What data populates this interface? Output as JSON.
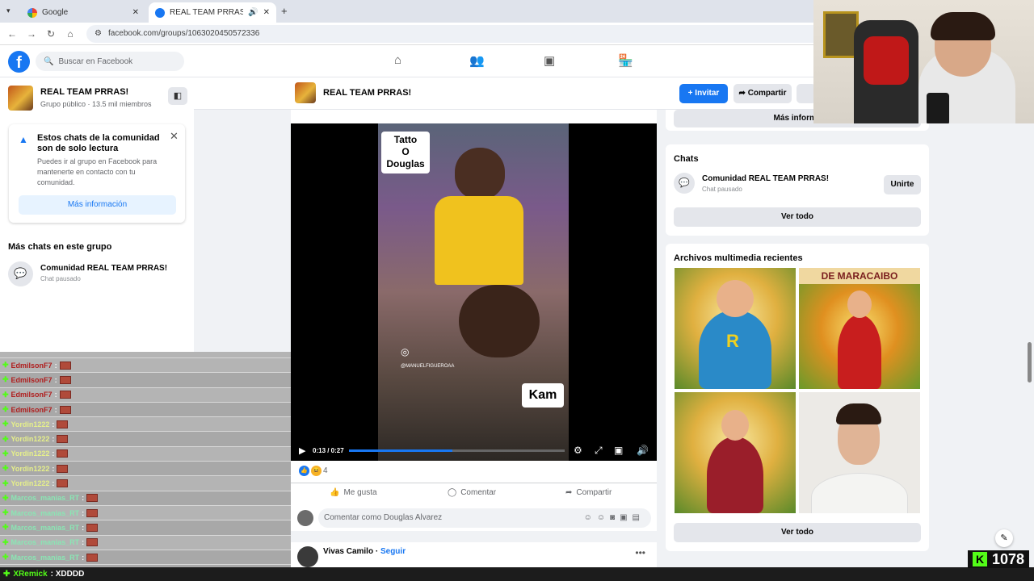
{
  "browser": {
    "tabs": [
      {
        "title": "Google",
        "active": false
      },
      {
        "title": "REAL TEAM PRRAS! | Faceb",
        "active": true
      }
    ],
    "url": "facebook.com/groups/1063020450572336"
  },
  "facebook": {
    "search_placeholder": "Buscar en Facebook",
    "group": {
      "name": "REAL TEAM PRRAS!",
      "meta": "Grupo público · 13.5 mil miembros"
    },
    "notice": {
      "title": "Estos chats de la comunidad son de solo lectura",
      "body": "Puedes ir al grupo en Facebook para mantenerte en contacto con tu comunidad.",
      "button": "Más información"
    },
    "more_chats_title": "Más chats en este grupo",
    "left_chat": {
      "name": "Comunidad REAL TEAM PRRAS!",
      "status": "Chat pausado"
    },
    "groupbar": {
      "title": "REAL TEAM PRRAS!",
      "invite": "Invitar",
      "share": "Compartir"
    }
  },
  "post": {
    "video_labels": {
      "top": [
        "Tatto",
        "O",
        "Douglas"
      ],
      "bottom": "Kam",
      "watermark": "@MANUELFIGUEROAA"
    },
    "video_time": "0:13 / 0:27",
    "video_progress": 0.48,
    "reaction_count": "4",
    "actions": {
      "like": "Me gusta",
      "comment": "Comentar",
      "share": "Compartir"
    },
    "comment_placeholder": "Comentar como Douglas Alvarez"
  },
  "post2": {
    "author": "Vivas Camilo",
    "separator": " · ",
    "follow": "Seguir"
  },
  "right": {
    "more_info_btn": "Más informa",
    "chats_title": "Chats",
    "chat": {
      "name": "Comunidad REAL TEAM PRRAS!",
      "status": "Chat pausado",
      "join": "Unirte"
    },
    "see_all": "Ver todo",
    "media_title": "Archivos multimedia recientes",
    "media_banner": "DE MARACAIBO",
    "media_letter": "R"
  },
  "stream_chat": {
    "rows": [
      {
        "user": "EdmilsonF7",
        "sep": " :",
        "color": "#b01e1e"
      },
      {
        "user": "EdmilsonF7",
        "sep": " :",
        "color": "#b01e1e"
      },
      {
        "user": "EdmilsonF7",
        "sep": " :",
        "color": "#b01e1e"
      },
      {
        "user": "EdmilsonF7",
        "sep": " :",
        "color": "#b01e1e"
      },
      {
        "user": "Yordin1222",
        "sep": " :",
        "color": "#e6f08a"
      },
      {
        "user": "Yordin1222",
        "sep": " :",
        "color": "#e6f08a"
      },
      {
        "user": "Yordin1222",
        "sep": " :",
        "color": "#e6f08a"
      },
      {
        "user": "Yordin1222",
        "sep": " :",
        "color": "#e6f08a"
      },
      {
        "user": "Yordin1222",
        "sep": " :",
        "color": "#e6f08a"
      },
      {
        "user": "Marcos_manias_RT",
        "sep": " :",
        "color": "#8ae6b4"
      },
      {
        "user": "Marcos_manias_RT",
        "sep": " :",
        "color": "#8ae6b4"
      },
      {
        "user": "Marcos_manias_RT",
        "sep": " :",
        "color": "#8ae6b4"
      },
      {
        "user": "Marcos_manias_RT",
        "sep": " :",
        "color": "#8ae6b4"
      },
      {
        "user": "Marcos_manias_RT",
        "sep": " :",
        "color": "#8ae6b4"
      }
    ],
    "last_line": {
      "user": "XRemick",
      "message": ": XDDDD"
    }
  },
  "stream_counter": {
    "kick_letter": "K",
    "viewers": "1078"
  }
}
